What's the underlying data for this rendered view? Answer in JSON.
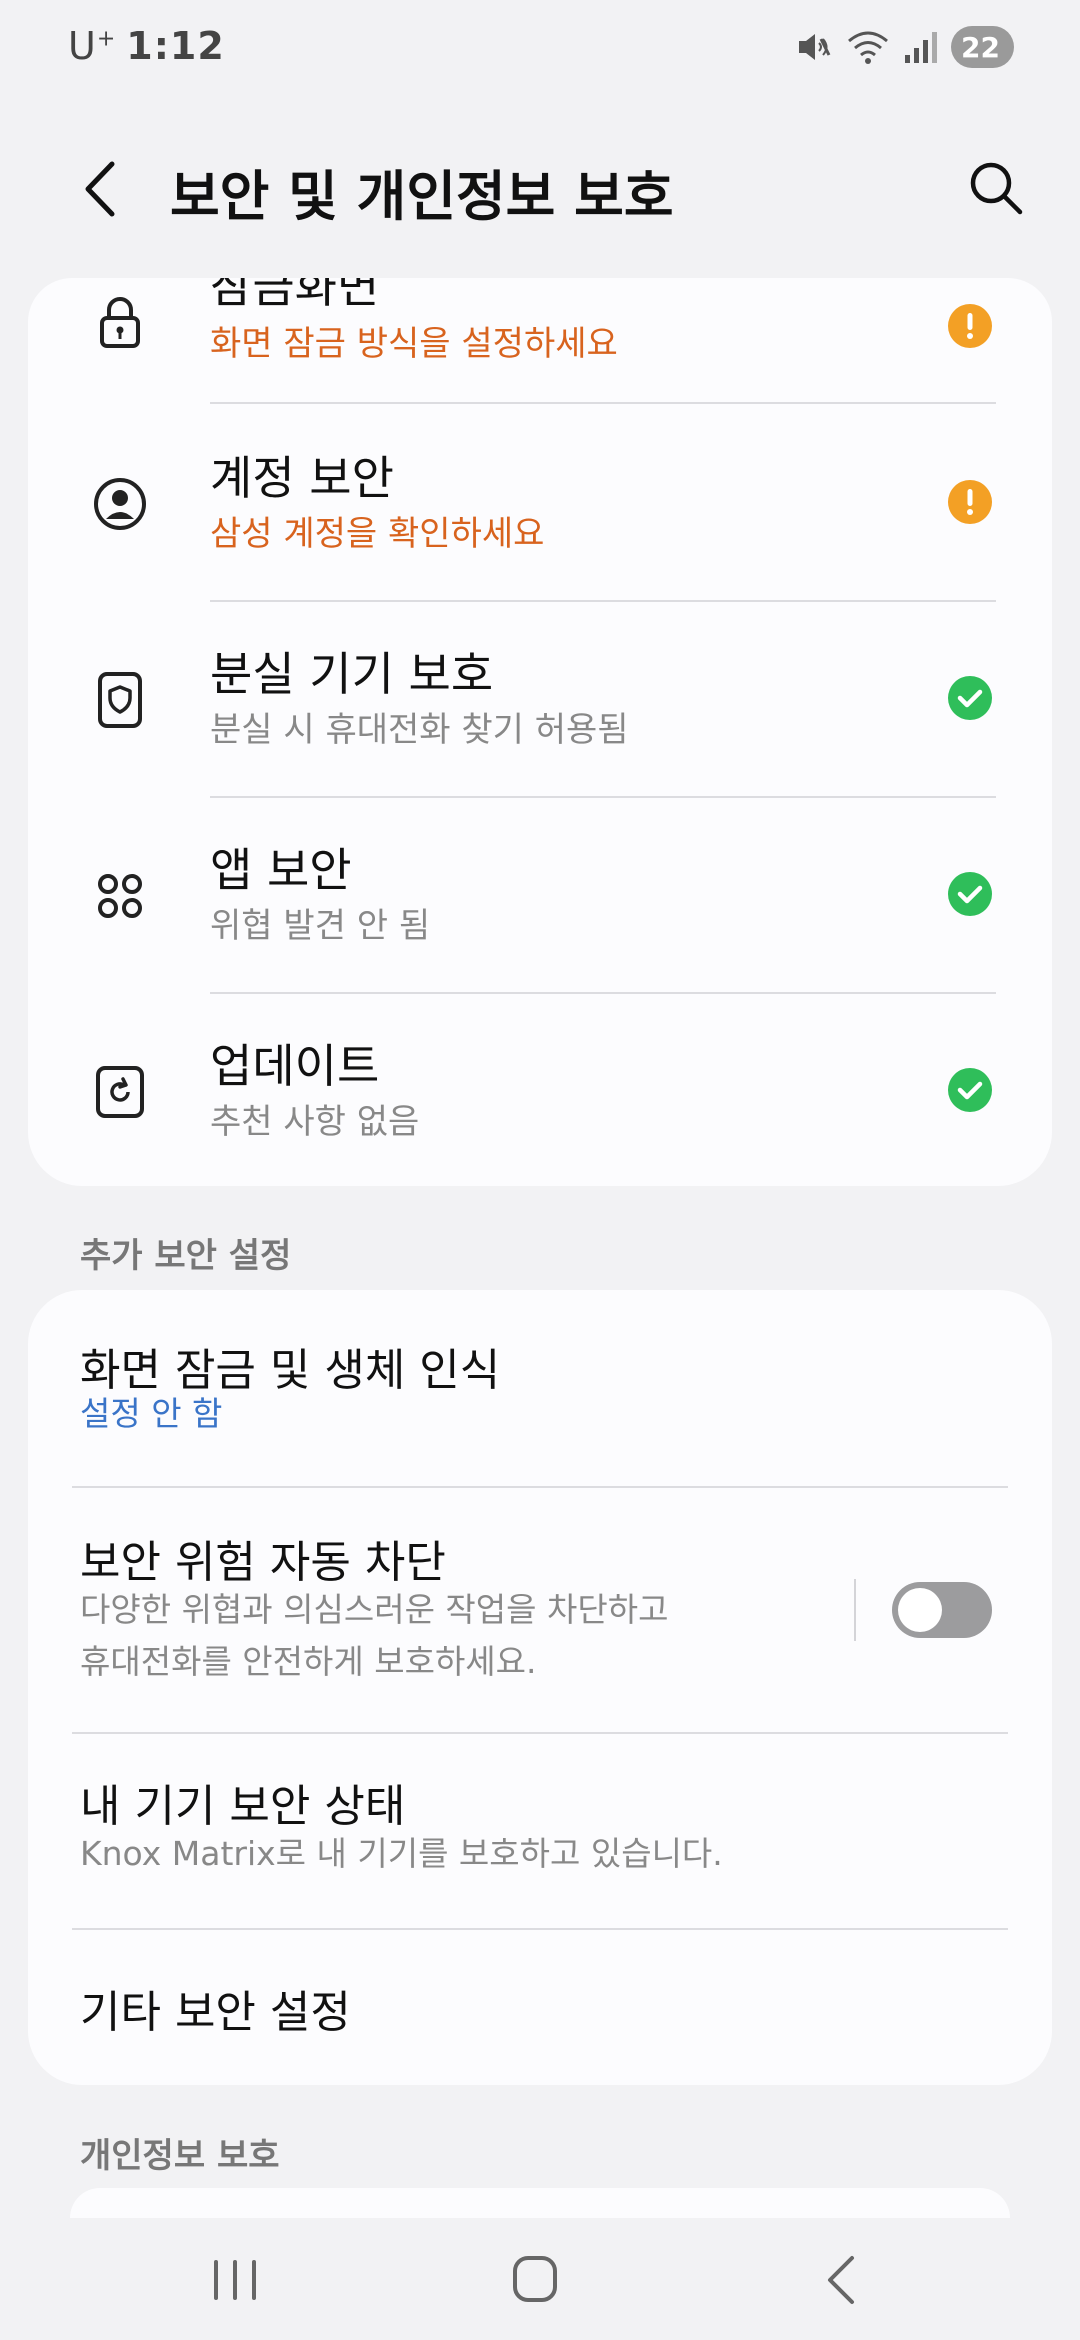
{
  "status_bar": {
    "carrier": "U",
    "carrier_sup": "+",
    "time": "1:12",
    "battery": "22"
  },
  "app_bar": {
    "title": "보안 및 개인정보 보호"
  },
  "security_items": [
    {
      "title": "잠금화면",
      "subtitle": "화면 잠금 방식을 설정하세요",
      "status": "warning",
      "icon": "lock-icon"
    },
    {
      "title": "계정 보안",
      "subtitle": "삼성 계정을 확인하세요",
      "status": "warning",
      "icon": "account-icon"
    },
    {
      "title": "분실 기기 보호",
      "subtitle": "분실 시 휴대전화 찾기 허용됨",
      "status": "ok",
      "icon": "shield-icon"
    },
    {
      "title": "앱 보안",
      "subtitle": "위협 발견 안 됨",
      "status": "ok",
      "icon": "apps-icon"
    },
    {
      "title": "업데이트",
      "subtitle": "추천 사항 없음",
      "status": "ok",
      "icon": "update-icon"
    }
  ],
  "sections": {
    "additional": "추가 보안 설정",
    "privacy": "개인정보 보호"
  },
  "additional_items": {
    "screen_lock": {
      "title": "화면 잠금 및 생체 인식",
      "subtitle": "설정 안 함"
    },
    "auto_block": {
      "title": "보안 위험 자동 차단",
      "subtitle_line1": "다양한 위협과 의심스러운 작업을 차단하고",
      "subtitle_line2": "휴대전화를 안전하게 보호하세요.",
      "toggle_on": false
    },
    "device_status": {
      "title": "내 기기 보안 상태",
      "subtitle": "Knox Matrix로 내 기기를 보호하고 있습니다."
    },
    "other": {
      "title": "기타 보안 설정"
    }
  },
  "colors": {
    "background": "#f2f2f4",
    "card": "#fcfcfe",
    "warning_text": "#d8631e",
    "warning_badge": "#f3a025",
    "ok_badge": "#2fbe5a",
    "link_blue": "#3a74c8"
  }
}
